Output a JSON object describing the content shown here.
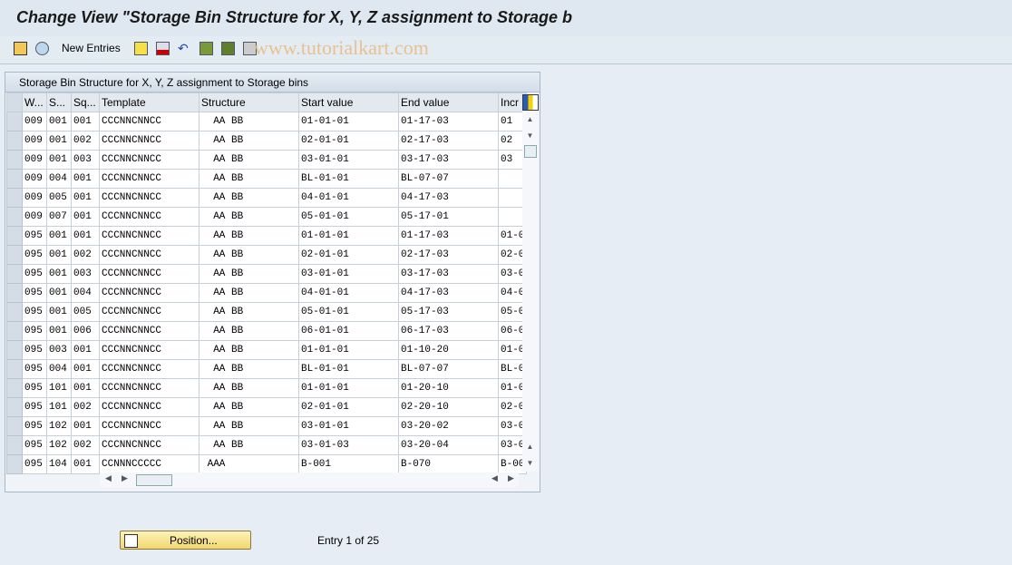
{
  "title": "Change View \"Storage Bin Structure for X, Y, Z assignment to Storage b",
  "toolbar": {
    "new_entries": "New Entries",
    "watermark": "www.tutorialkart.com"
  },
  "panel": {
    "title": "Storage Bin Structure for X, Y, Z assignment to Storage bins"
  },
  "columns": [
    "W...",
    "S...",
    "Sq...",
    "Template",
    "Structure",
    "Start value",
    "End value",
    "Incr"
  ],
  "rows": [
    [
      "009",
      "001",
      "001",
      "CCCNNCNNCC",
      "  AA BB",
      "01-01-01",
      "01-17-03",
      "01"
    ],
    [
      "009",
      "001",
      "002",
      "CCCNNCNNCC",
      "  AA BB",
      "02-01-01",
      "02-17-03",
      "02"
    ],
    [
      "009",
      "001",
      "003",
      "CCCNNCNNCC",
      "  AA BB",
      "03-01-01",
      "03-17-03",
      "03"
    ],
    [
      "009",
      "004",
      "001",
      "CCCNNCNNCC",
      "  AA BB",
      "BL-01-01",
      "BL-07-07",
      ""
    ],
    [
      "009",
      "005",
      "001",
      "CCCNNCNNCC",
      "  AA BB",
      "04-01-01",
      "04-17-03",
      ""
    ],
    [
      "009",
      "007",
      "001",
      "CCCNNCNNCC",
      "  AA BB",
      "05-01-01",
      "05-17-01",
      ""
    ],
    [
      "095",
      "001",
      "001",
      "CCCNNCNNCC",
      "  AA BB",
      "01-01-01",
      "01-17-03",
      "01-0"
    ],
    [
      "095",
      "001",
      "002",
      "CCCNNCNNCC",
      "  AA BB",
      "02-01-01",
      "02-17-03",
      "02-0"
    ],
    [
      "095",
      "001",
      "003",
      "CCCNNCNNCC",
      "  AA BB",
      "03-01-01",
      "03-17-03",
      "03-0"
    ],
    [
      "095",
      "001",
      "004",
      "CCCNNCNNCC",
      "  AA BB",
      "04-01-01",
      "04-17-03",
      "04-0"
    ],
    [
      "095",
      "001",
      "005",
      "CCCNNCNNCC",
      "  AA BB",
      "05-01-01",
      "05-17-03",
      "05-0"
    ],
    [
      "095",
      "001",
      "006",
      "CCCNNCNNCC",
      "  AA BB",
      "06-01-01",
      "06-17-03",
      "06-0"
    ],
    [
      "095",
      "003",
      "001",
      "CCCNNCNNCC",
      "  AA BB",
      "01-01-01",
      "01-10-20",
      "01-0"
    ],
    [
      "095",
      "004",
      "001",
      "CCCNNCNNCC",
      "  AA BB",
      "BL-01-01",
      "BL-07-07",
      "BL-0"
    ],
    [
      "095",
      "101",
      "001",
      "CCCNNCNNCC",
      "  AA BB",
      "01-01-01",
      "01-20-10",
      "01-0"
    ],
    [
      "095",
      "101",
      "002",
      "CCCNNCNNCC",
      "  AA BB",
      "02-01-01",
      "02-20-10",
      "02-0"
    ],
    [
      "095",
      "102",
      "001",
      "CCCNNCNNCC",
      "  AA BB",
      "03-01-01",
      "03-20-02",
      "03-0"
    ],
    [
      "095",
      "102",
      "002",
      "CCCNNCNNCC",
      "  AA BB",
      "03-01-03",
      "03-20-04",
      "03-0"
    ],
    [
      "095",
      "104",
      "001",
      "CCNNNCCCCC",
      " AAA",
      "B-001",
      "B-070",
      "B-00"
    ]
  ],
  "footer": {
    "position_label": "Position...",
    "entry_text": "Entry 1 of 25"
  }
}
